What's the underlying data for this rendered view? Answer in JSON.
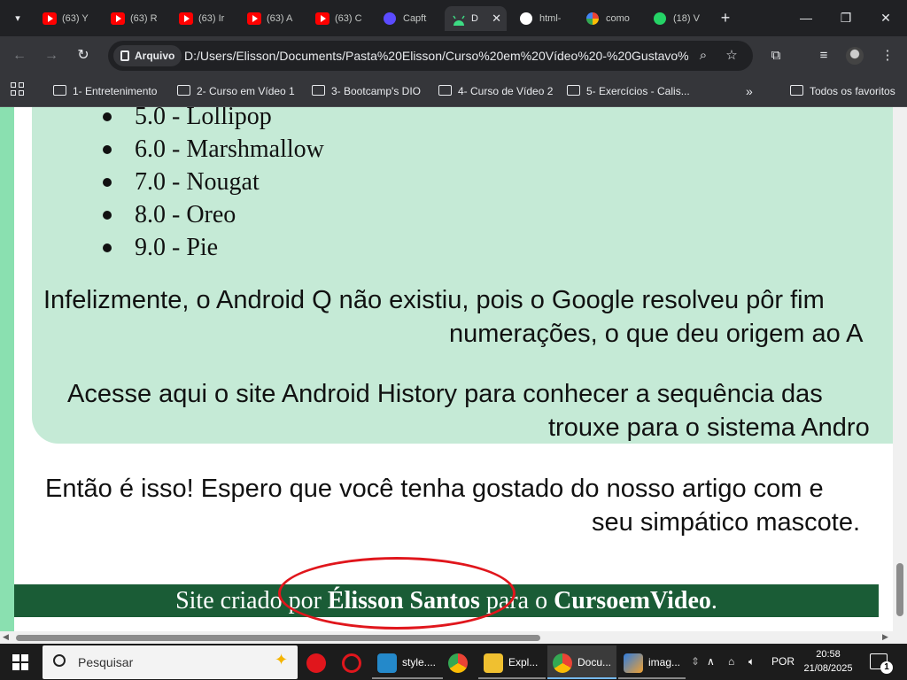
{
  "browser": {
    "tabs": [
      {
        "label": "(63) Y",
        "icon": "youtube-icon"
      },
      {
        "label": "(63) R",
        "icon": "youtube-icon"
      },
      {
        "label": "(63) Ir",
        "icon": "youtube-icon"
      },
      {
        "label": "(63) A",
        "icon": "youtube-icon"
      },
      {
        "label": "(63) C",
        "icon": "youtube-icon"
      },
      {
        "label": "Capft",
        "icon": "capcut-icon"
      },
      {
        "label": "D",
        "icon": "android-icon",
        "active": true
      },
      {
        "label": "html-",
        "icon": "github-icon"
      },
      {
        "label": "como",
        "icon": "google-icon"
      },
      {
        "label": "(18) V",
        "icon": "whatsapp-icon"
      }
    ],
    "address": {
      "scheme_label": "Arquivo",
      "url": "D:/Users/Elisson/Documents/Pasta%20Elisson/Curso%20em%20Vídeo%20-%20Gustavo%..."
    },
    "bookmarks": [
      "1- Entretenimento",
      "2- Curso em Vídeo 1",
      "3- Bootcamp's DIO",
      "4- Curso de Vídeo 2",
      "5- Exercícios - Calis..."
    ],
    "bookmarks_overflow": "»",
    "all_favorites": "Todos os favoritos"
  },
  "page": {
    "android_versions": [
      "5.0 - Lollipop",
      "6.0 - Marshmallow",
      "7.0 - Nougat",
      "8.0 - Oreo",
      "9.0 - Pie"
    ],
    "para_android_q": {
      "line1": "Infelizmente, o Android Q não existiu, pois o Google resolveu pôr fim",
      "line2": "numerações, o que deu origem ao A"
    },
    "para_history": {
      "line1": "Acesse aqui o site Android History para conhecer a sequência das",
      "line2": "trouxe para o sistema Andro"
    },
    "para_end": {
      "line1": "Então é isso! Espero que você tenha gostado do nosso artigo com e",
      "line2": "seu simpático mascote."
    },
    "footer": {
      "prefix": "Site criado por ",
      "author": "Élisson Santos",
      "middle": " para o ",
      "site": "CursoemVideo",
      "suffix": "."
    },
    "colors": {
      "article_bg": "#c5ead6",
      "outer_bg": "#8ae0b0",
      "footer_bg": "#1a5c36",
      "annotation": "#e0161c"
    }
  },
  "taskbar": {
    "search_placeholder": "Pesquisar",
    "apps": [
      {
        "label": "",
        "icon": "opera-gx-icon"
      },
      {
        "label": "",
        "icon": "opera-icon"
      },
      {
        "label": "style....",
        "icon": "vscode-icon"
      },
      {
        "label": "",
        "icon": "chrome-icon"
      },
      {
        "label": "Expl...",
        "icon": "file-explorer-icon"
      },
      {
        "label": "Docu...",
        "icon": "chrome-icon",
        "active": true
      },
      {
        "label": "imag...",
        "icon": "paint-icon"
      }
    ],
    "language": "POR",
    "time": "20:58",
    "date": "21/08/2025",
    "notification_count": "1"
  }
}
